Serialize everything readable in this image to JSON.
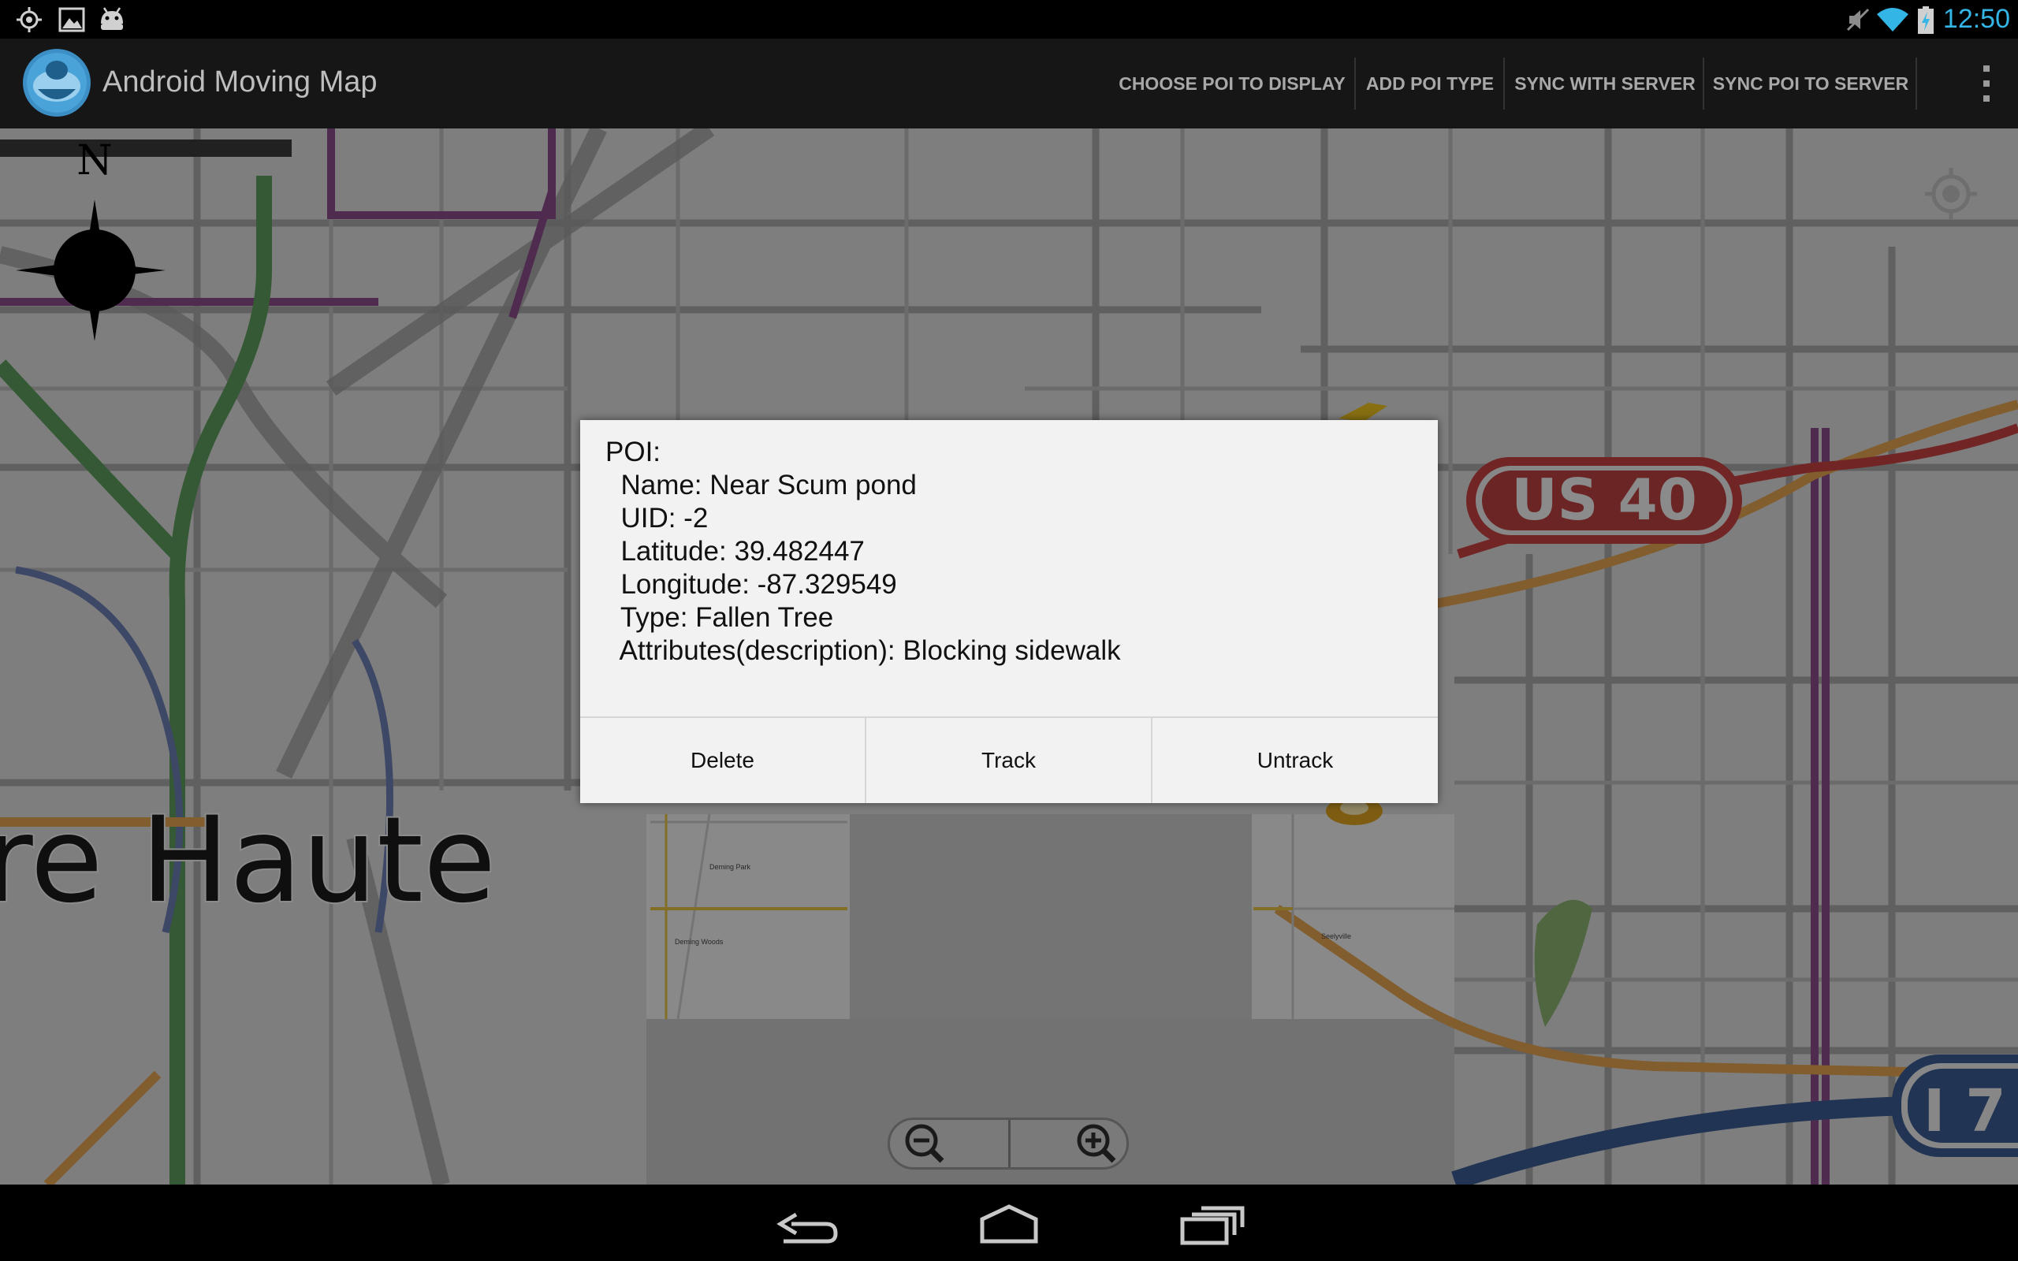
{
  "status_bar": {
    "time": "12:50",
    "left_icons": [
      "location-target-icon",
      "gallery-icon",
      "android-debug-icon"
    ],
    "right_icons": [
      "mute-icon",
      "wifi-icon",
      "battery-charging-icon"
    ],
    "time_color": "#33b5e5"
  },
  "action_bar": {
    "title": "Android Moving Map",
    "actions": {
      "choose_poi": "CHOOSE POI TO DISPLAY",
      "add_poi_type": "ADD POI TYPE",
      "sync_with_server": "SYNC WITH SERVER",
      "sync_poi_to_server": "SYNC POI TO SERVER"
    },
    "overflow_icon": "overflow-menu-icon"
  },
  "map": {
    "compass_label": "N",
    "city_label": "re Haute",
    "highway_shield": "US 40",
    "interstate_shield": "I 7",
    "small_labels": {
      "park1": "Deming Park",
      "park2": "Deming Woods",
      "area": "Seelyville"
    }
  },
  "dialog": {
    "message": "POI:\n  Name: Near Scum pond\n  UID: -2\n  Latitude: 39.482447\n  Longitude: -87.329549\n  Type: Fallen Tree\n  Attributes(description): Blocking sidewalk",
    "buttons": {
      "delete": "Delete",
      "track": "Track",
      "untrack": "Untrack"
    }
  },
  "nav_bar": {
    "icons": [
      "back-icon",
      "home-icon",
      "recent-apps-icon"
    ]
  }
}
